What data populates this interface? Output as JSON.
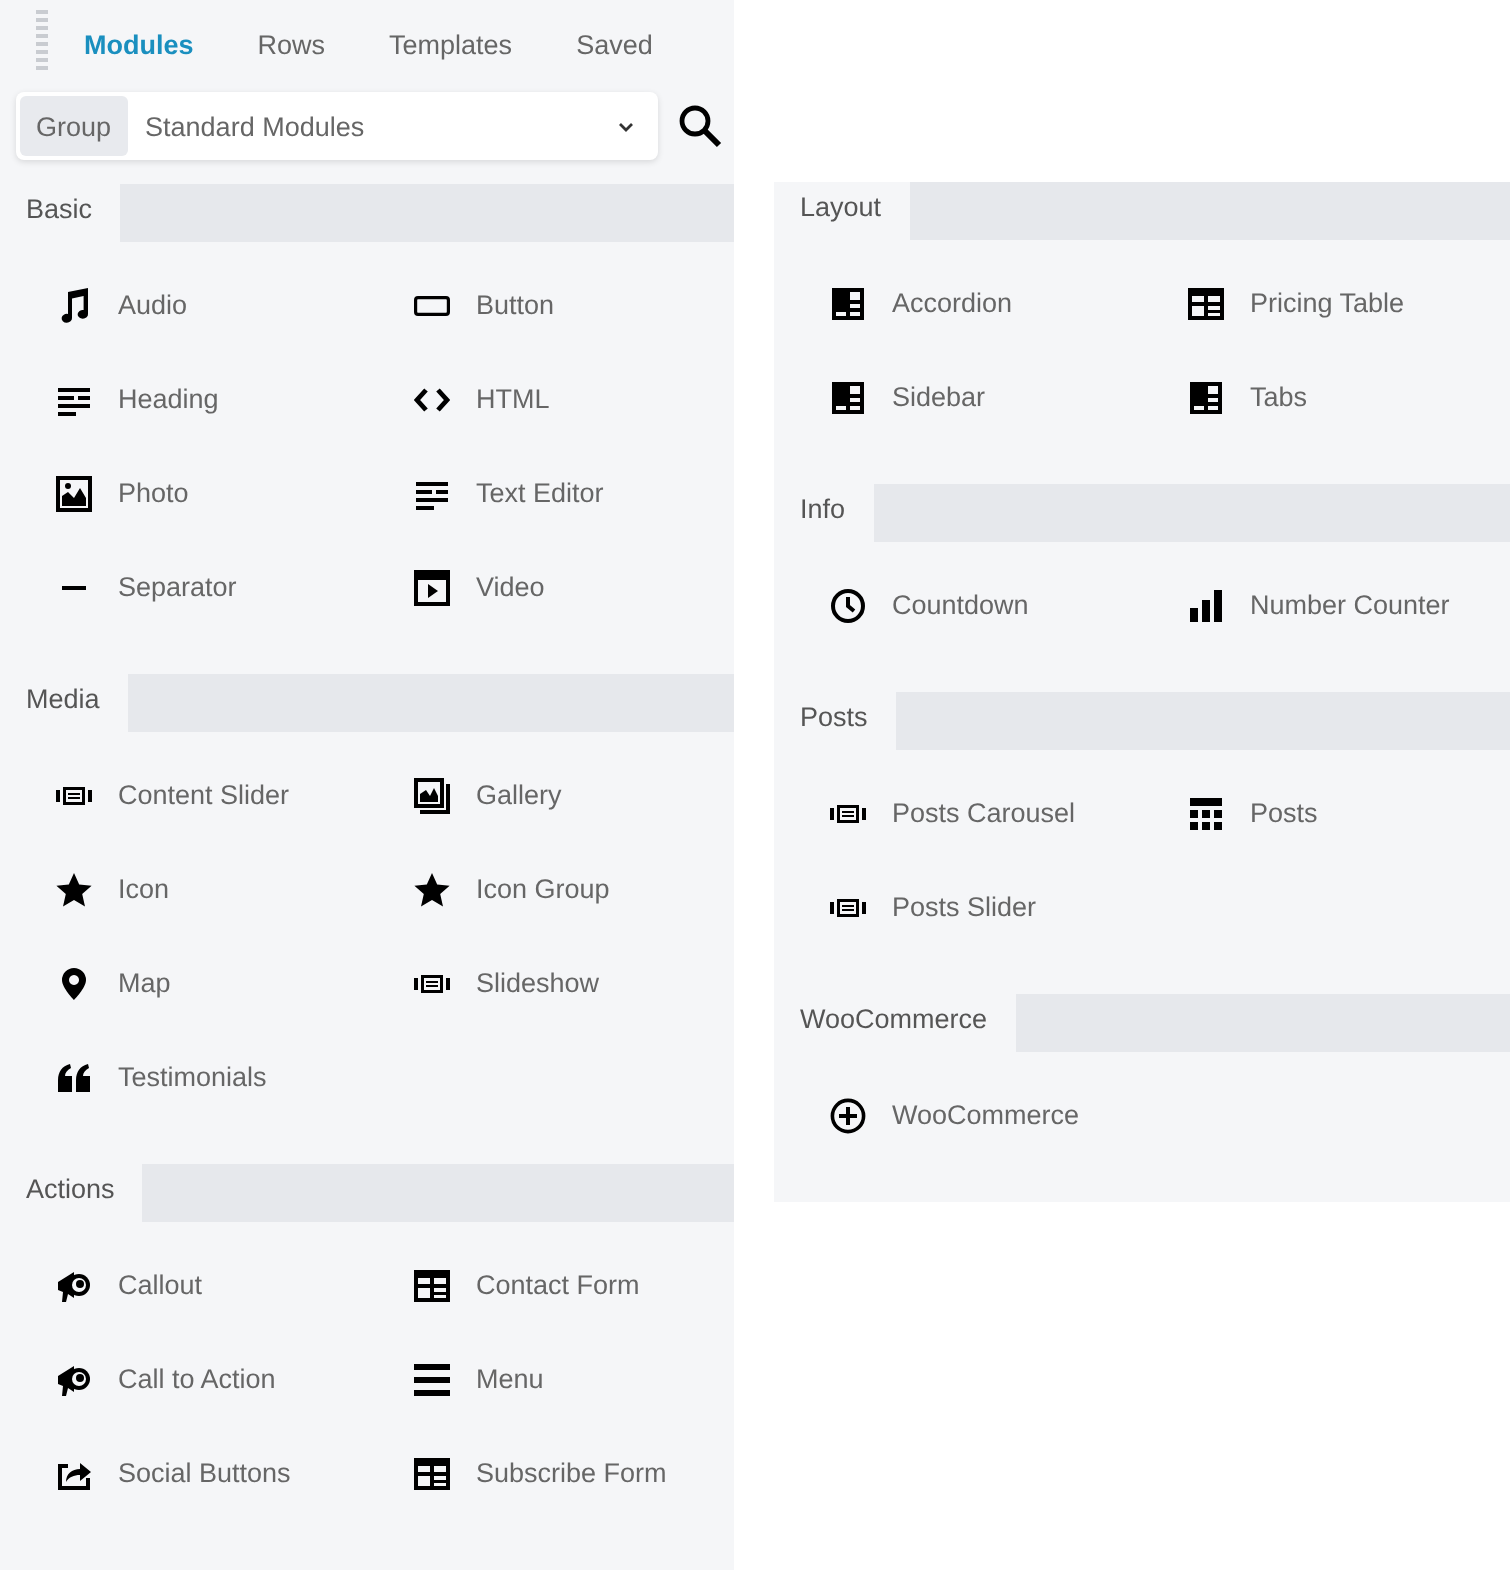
{
  "left_panel": {
    "tabs": [
      {
        "label": "Modules",
        "selected": true
      },
      {
        "label": "Rows",
        "selected": false
      },
      {
        "label": "Templates",
        "selected": false
      },
      {
        "label": "Saved",
        "selected": false
      }
    ],
    "group_label": "Group",
    "group_value": "Standard Modules",
    "sections": [
      {
        "title": "Basic",
        "items": [
          "Audio",
          "Button",
          "Heading",
          "HTML",
          "Photo",
          "Text Editor",
          "Separator",
          "Video"
        ]
      },
      {
        "title": "Media",
        "items": [
          "Content Slider",
          "Gallery",
          "Icon",
          "Icon Group",
          "Map",
          "Slideshow",
          "Testimonials"
        ]
      },
      {
        "title": "Actions",
        "items": [
          "Callout",
          "Contact Form",
          "Call to Action",
          "Menu",
          "Social Buttons",
          "Subscribe Form"
        ]
      }
    ]
  },
  "right_panel": {
    "sections": [
      {
        "title": "Layout",
        "items": [
          "Accordion",
          "Pricing Table",
          "Sidebar",
          "Tabs"
        ]
      },
      {
        "title": "Info",
        "items": [
          "Countdown",
          "Number Counter"
        ]
      },
      {
        "title": "Posts",
        "items": [
          "Posts Carousel",
          "Posts",
          "Posts Slider"
        ]
      },
      {
        "title": "WooCommerce",
        "items": [
          "WooCommerce"
        ]
      }
    ]
  }
}
